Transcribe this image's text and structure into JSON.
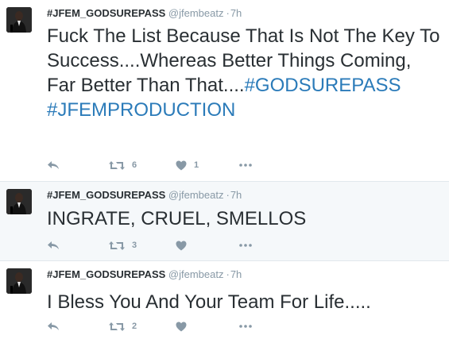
{
  "tweets": [
    {
      "name": "#JFEM_GODSUREPASS",
      "handle": "@jfembeatz",
      "separator": "·",
      "time": "7h",
      "text_plain": "Fuck The List Because That Is Not The Key To Success....Whereas Better Things Coming, Far Better Than That....",
      "hashtag1": "#GODSUREPASS",
      "hashtag2": "#JFEMPRODUCTION",
      "retweets": "6",
      "likes": "1"
    },
    {
      "name": "#JFEM_GODSUREPASS",
      "handle": "@jfembeatz",
      "separator": "·",
      "time": "7h",
      "text_plain": "INGRATE, CRUEL, SMELLOS",
      "retweets": "3",
      "likes": ""
    },
    {
      "name": "#JFEM_GODSUREPASS",
      "handle": "@jfembeatz",
      "separator": "·",
      "time": "7h",
      "text_plain": "I Bless You And Your Team For Life.....",
      "retweets": "2",
      "likes": ""
    }
  ],
  "icons": {
    "reply": "reply-icon",
    "retweet": "retweet-icon",
    "like": "heart-icon",
    "more": "more-icon",
    "avatar": "avatar-photo"
  },
  "colors": {
    "hashtag": "#2b7bb9",
    "muted": "#8899a6",
    "text": "#292f33",
    "highlight_bg": "#f5f8fa"
  }
}
